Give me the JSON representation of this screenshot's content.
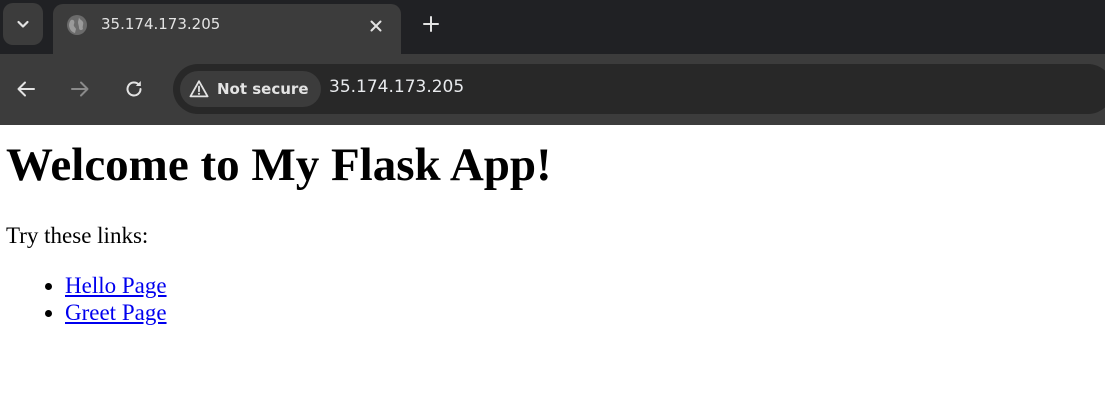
{
  "browser": {
    "tab": {
      "title": "35.174.173.205"
    },
    "toolbar": {
      "security_label": "Not secure",
      "url": "35.174.173.205"
    },
    "icons": {
      "tab_search": "chevron-down-icon",
      "favicon": "globe-icon",
      "close": "close-icon",
      "new_tab": "plus-icon",
      "back": "back-arrow-icon",
      "forward": "forward-arrow-icon",
      "reload": "reload-icon",
      "security": "warning-triangle-icon"
    },
    "colors": {
      "tabstrip_bg": "#202124",
      "toolbar_bg": "#3c3c3c",
      "omnibox_bg": "#282828",
      "link": "#0000ee"
    }
  },
  "page": {
    "heading": "Welcome to My Flask App!",
    "intro": "Try these links:",
    "links": [
      {
        "label": "Hello Page"
      },
      {
        "label": "Greet Page"
      }
    ]
  }
}
